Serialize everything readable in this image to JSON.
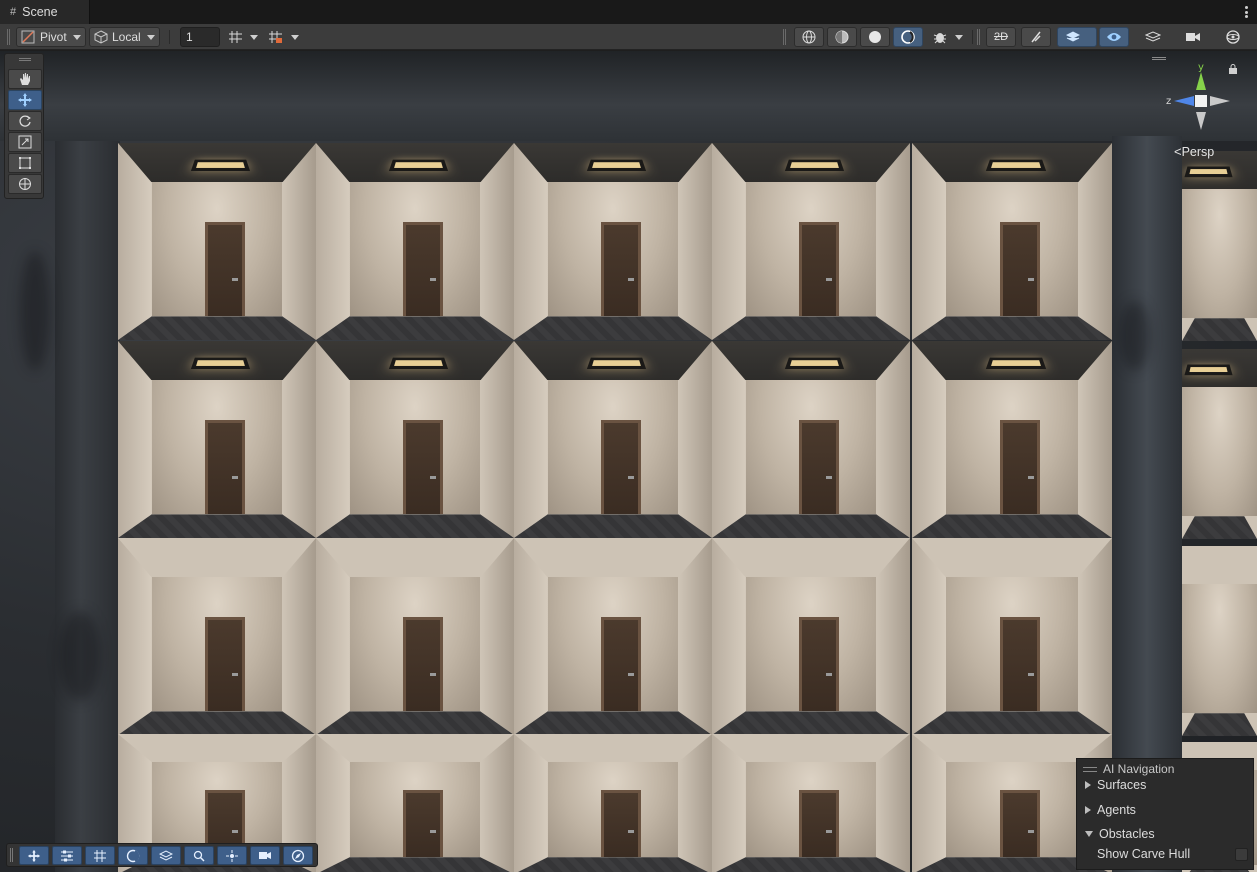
{
  "tab": {
    "title": "Scene",
    "icon": "hash-grid-icon"
  },
  "toolbar": {
    "pivot_label": "Pivot",
    "space_label": "Local",
    "snap_value": "1",
    "shading_modes": [
      "wireframe",
      "shaded-wire",
      "shaded",
      "unlit"
    ],
    "toggle_2d_label": "2D"
  },
  "gizmo": {
    "y_label": "y",
    "z_label": "z",
    "projection_label": "Persp",
    "colors": {
      "y": "#86d24a",
      "z": "#4f86e8",
      "x": "#d0d0d0"
    }
  },
  "tools": [
    "hand-icon",
    "move-icon",
    "rotate-icon",
    "scale-icon",
    "rect-icon",
    "transform-icon"
  ],
  "bottom_overlay": [
    "move-icon",
    "sliders-icon",
    "grid-icon",
    "lighting-icon",
    "layers-icon",
    "search-icon",
    "pivot-icon",
    "camera-icon",
    "compass-icon"
  ],
  "ai_navigation": {
    "title": "AI Navigation",
    "sections": [
      {
        "label": "Surfaces",
        "expanded": false
      },
      {
        "label": "Agents",
        "expanded": false
      },
      {
        "label": "Obstacles",
        "expanded": true
      }
    ],
    "option_label": "Show Carve Hull",
    "option_checked": false
  },
  "accent_color": "#3e5f8a"
}
